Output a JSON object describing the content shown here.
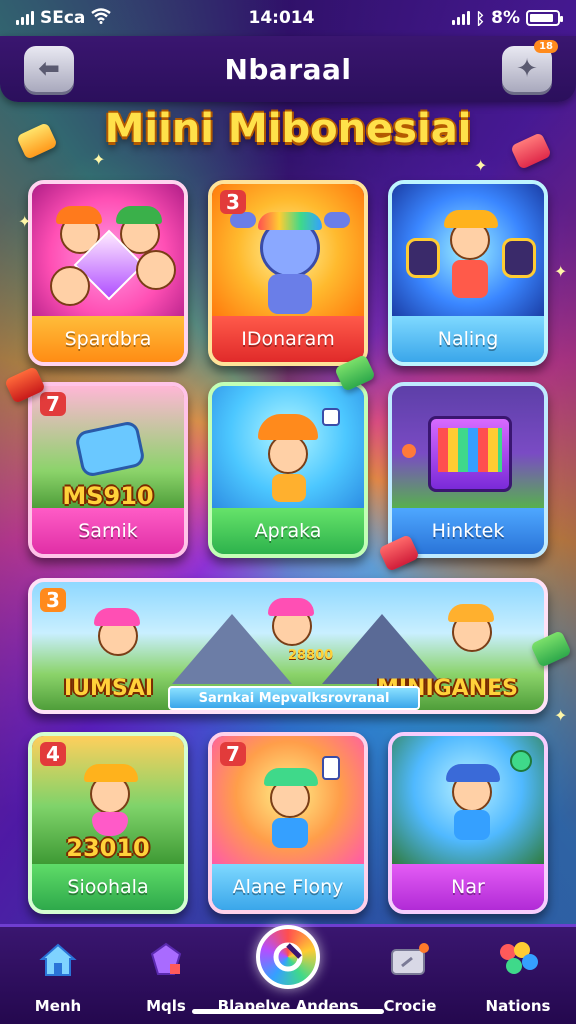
{
  "status": {
    "carrier": "SEca",
    "time": "14:014",
    "battery": "8%"
  },
  "header": {
    "title": "Nbaraal",
    "notif_badge": "18"
  },
  "headline": "Miini Mibonesiai",
  "cards": [
    {
      "label": "Spardbra",
      "number": ""
    },
    {
      "label": "IDonaram",
      "number": "3"
    },
    {
      "label": "Naling",
      "number": ""
    },
    {
      "label": "Sarnik",
      "number": "7",
      "score": "MS910"
    },
    {
      "label": "Apraka",
      "number": ""
    },
    {
      "label": "Hinktek",
      "number": ""
    },
    {
      "label": "Sioohala",
      "number": "4",
      "score": "23010"
    },
    {
      "label": "Alane Flony",
      "number": "7"
    },
    {
      "label": "Nar",
      "number": ""
    }
  ],
  "banner": {
    "number": "3",
    "left": "IUMSAI",
    "right": "MINIGANES",
    "score": "28800",
    "strip": "Sarnkai Mepvalksrovranal"
  },
  "tabs": [
    {
      "label": "Menh"
    },
    {
      "label": "Mqls"
    },
    {
      "label": "Blapelve Andens"
    },
    {
      "label": "Crocie"
    },
    {
      "label": "Nations"
    }
  ],
  "colors": {
    "topbar": "#2b0f5c",
    "headline": "#ffe14a",
    "tabbar": "#24084e"
  }
}
